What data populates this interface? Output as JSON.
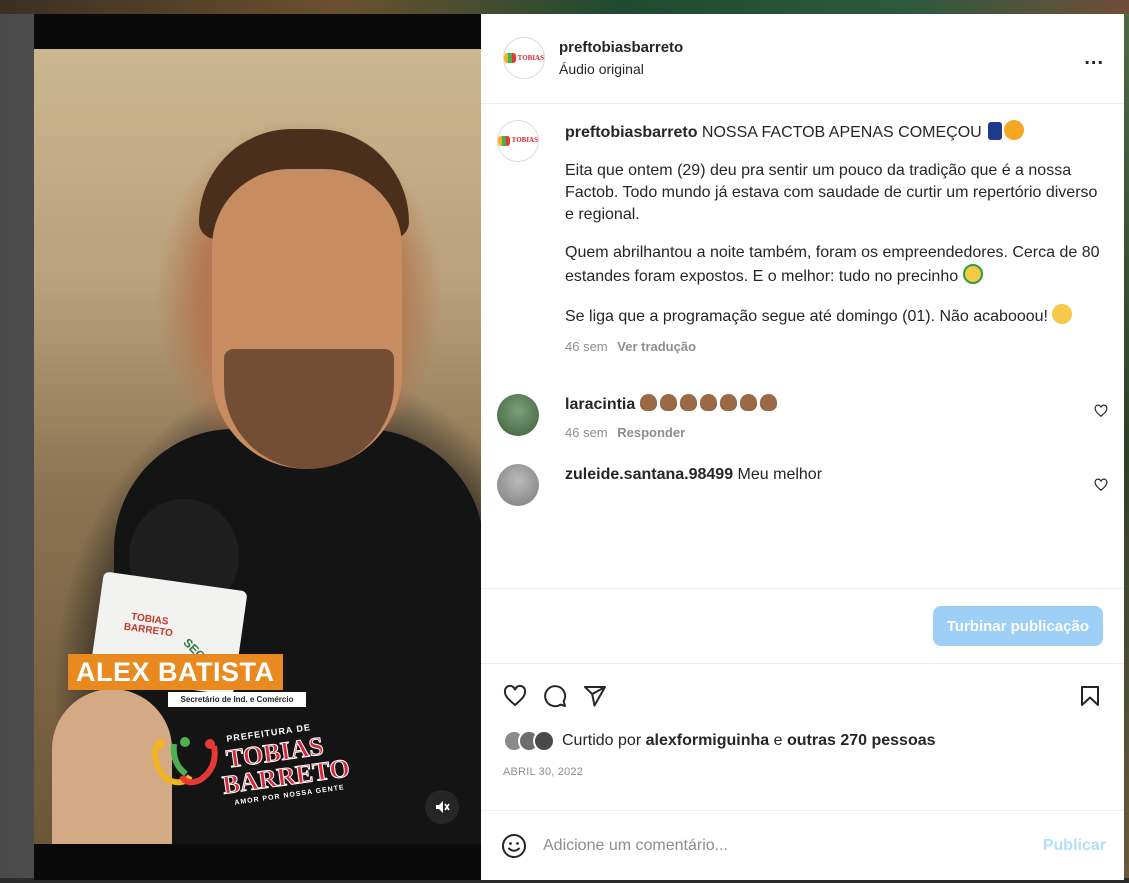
{
  "post": {
    "username": "preftobiasbarreto",
    "audio": "Áudio original",
    "more_label": "...",
    "caption_title": "NOSSA FACTOB APENAS COMEÇOU",
    "caption_p1": "Eita que ontem (29) deu pra sentir um pouco da tradição que é a nossa Factob. Todo mundo já estava com saudade de curtir um repertório diverso e regional.",
    "caption_p2": "Quem abrilhantou a noite também, foram os empreendedores. Cerca de 80 estandes foram expostos. E o melhor: tudo no precinho",
    "caption_p3": "Se liga que a programação segue até domingo (01). Não acabooou!",
    "time": "46 sem",
    "translate": "Ver tradução",
    "date": "ABRIL 30, 2022"
  },
  "video_overlay": {
    "name": "ALEX BATISTA",
    "role": "Secretário de Ind. e Comércio",
    "brand_small": "PREFEITURA DE",
    "brand_line1": "TOBIAS",
    "brand_line2": "BARRETO",
    "brand_tag": "AMOR POR NOSSA GENTE",
    "mic_brand": "TOBIAS BARRETO",
    "mic_label": "SECOM"
  },
  "comments": [
    {
      "username": "laracintia",
      "text": "",
      "time": "46 sem",
      "reply": "Responder",
      "claps": 7
    },
    {
      "username": "zuleide.santana.98499",
      "text": "Meu melhor"
    }
  ],
  "boost_label": "Turbinar publicação",
  "likes": {
    "prefix": "Curtido por",
    "user": "alexformiguinha",
    "joiner": "e",
    "others": "outras 270 pessoas"
  },
  "add_comment": {
    "placeholder": "Adicione um comentário...",
    "publish": "Publicar"
  },
  "icons": {
    "like": "heart-icon",
    "comment": "comment-icon",
    "share": "share-icon",
    "save": "bookmark-icon",
    "mute": "mute-icon",
    "emoji": "emoji-icon"
  },
  "colors": {
    "boost_button": "#9dcff7",
    "publish_disabled": "#b2dffc",
    "nameplate": "#e98a20",
    "brand_red": "#d62839"
  }
}
